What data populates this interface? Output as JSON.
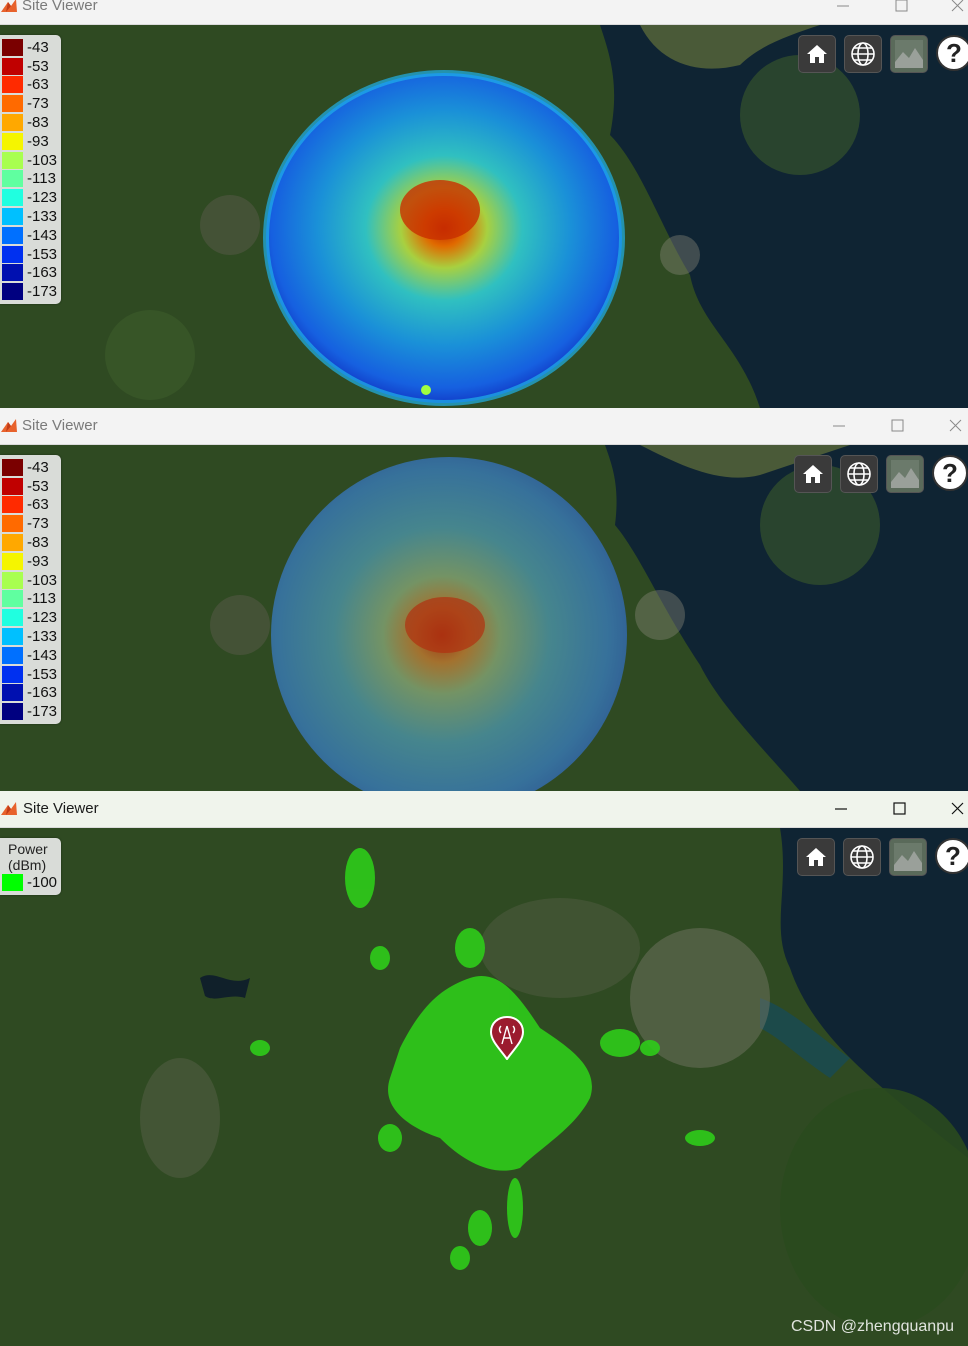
{
  "windows": [
    {
      "title": "Site Viewer",
      "legend": {
        "title": "",
        "entries": [
          {
            "label": "-43",
            "color": "#7a0000"
          },
          {
            "label": "-53",
            "color": "#c00000"
          },
          {
            "label": "-63",
            "color": "#ff2a00"
          },
          {
            "label": "-73",
            "color": "#ff6a00"
          },
          {
            "label": "-83",
            "color": "#ffa800"
          },
          {
            "label": "-93",
            "color": "#f5f500"
          },
          {
            "label": "-103",
            "color": "#a8ff50"
          },
          {
            "label": "-113",
            "color": "#60ffa0"
          },
          {
            "label": "-123",
            "color": "#20ffe0"
          },
          {
            "label": "-133",
            "color": "#00c0ff"
          },
          {
            "label": "-143",
            "color": "#0070ff"
          },
          {
            "label": "-153",
            "color": "#0030f0"
          },
          {
            "label": "-163",
            "color": "#0010b0"
          },
          {
            "label": "-173",
            "color": "#000080"
          }
        ]
      }
    },
    {
      "title": "Site Viewer",
      "legend": {
        "title": "",
        "entries": [
          {
            "label": "-43",
            "color": "#7a0000"
          },
          {
            "label": "-53",
            "color": "#c00000"
          },
          {
            "label": "-63",
            "color": "#ff2a00"
          },
          {
            "label": "-73",
            "color": "#ff6a00"
          },
          {
            "label": "-83",
            "color": "#ffa800"
          },
          {
            "label": "-93",
            "color": "#f5f500"
          },
          {
            "label": "-103",
            "color": "#a8ff50"
          },
          {
            "label": "-113",
            "color": "#60ffa0"
          },
          {
            "label": "-123",
            "color": "#20ffe0"
          },
          {
            "label": "-133",
            "color": "#00c0ff"
          },
          {
            "label": "-143",
            "color": "#0070ff"
          },
          {
            "label": "-153",
            "color": "#0030f0"
          },
          {
            "label": "-163",
            "color": "#0010b0"
          },
          {
            "label": "-173",
            "color": "#000080"
          }
        ]
      }
    },
    {
      "title": "Site Viewer",
      "legend": {
        "title_line1": "Power",
        "title_line2": "(dBm)",
        "entries": [
          {
            "label": "-100",
            "color": "#00ff00"
          }
        ]
      }
    }
  ],
  "toolbar_icons": [
    "home-icon",
    "globe-icon",
    "basemap-icon",
    "help-icon"
  ],
  "help_symbol": "?",
  "watermark": "CSDN @zhengquanpu",
  "colors": {
    "coverage_green": "#2ecc1a",
    "site_marker": "#9b1b2e",
    "sea": "#0f2433",
    "land": "#2f4a22"
  }
}
